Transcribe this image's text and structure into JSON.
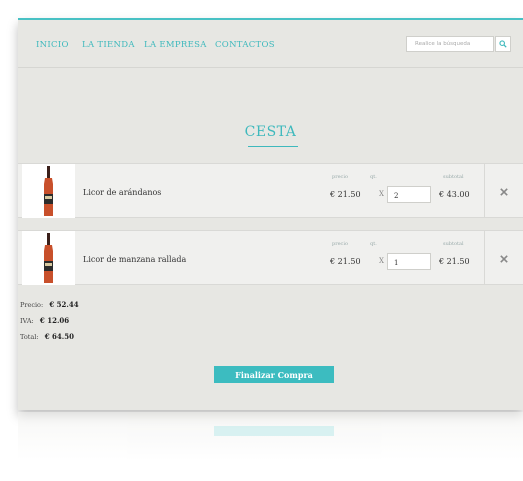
{
  "nav": {
    "links": [
      "INICIO",
      "LA TIENDA",
      "LA EMPRESA",
      "CONTACTOS"
    ],
    "search_placeholder": "Realice la búsqueda",
    "search_icon": "search-icon"
  },
  "page": {
    "title": "CESTA"
  },
  "cart": {
    "labels": {
      "price": "precio",
      "qty": "qt.",
      "subtotal": "subtotal"
    },
    "items": [
      {
        "name": "Licor de arándanos",
        "price": "€ 21.50",
        "times": "X",
        "qty": "2",
        "subtotal": "€ 43.00",
        "remove_icon": "close-icon"
      },
      {
        "name": "Licor de manzana rallada",
        "price": "€ 21.50",
        "times": "X",
        "qty": "1",
        "subtotal": "€ 21.50",
        "remove_icon": "close-icon"
      }
    ]
  },
  "totals": {
    "price_label": "Precio:",
    "price_value": "€ 52.44",
    "iva_label": "IVA:",
    "iva_value": "€ 12.06",
    "total_label": "Total:",
    "total_value": "€ 64.50"
  },
  "checkout": {
    "label": "Finalizar Compra"
  },
  "colors": {
    "accent": "#3cbcc0",
    "background": "#e7e7e3"
  }
}
